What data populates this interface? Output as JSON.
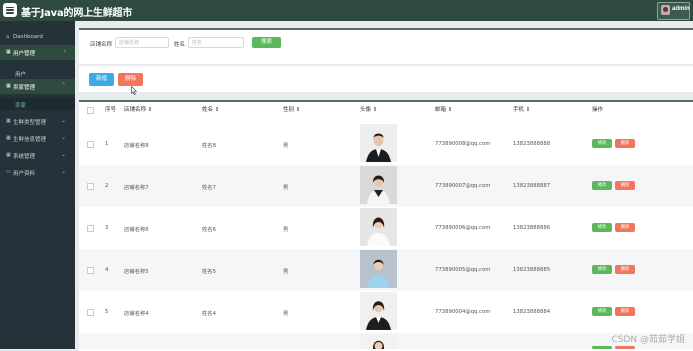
{
  "header": {
    "title": "基于Java的网上生鲜超市",
    "user": "admin"
  },
  "sidebar": {
    "items": [
      {
        "label": "Dashboard",
        "icon": "home-icon",
        "active": false
      },
      {
        "label": "用户管理",
        "icon": "grid-icon",
        "active": true,
        "sub": [
          "用户"
        ]
      },
      {
        "label": "卖家管理",
        "icon": "grid-icon",
        "active": true,
        "sub": [
          "卖家"
        ]
      },
      {
        "label": "生鲜类型管理",
        "icon": "grid-icon",
        "active": false
      },
      {
        "label": "生鲜信息管理",
        "icon": "grid-icon",
        "active": false
      },
      {
        "label": "系统管理",
        "icon": "grid-icon",
        "active": false
      },
      {
        "label": "用户资料",
        "icon": "user-icon",
        "active": false
      }
    ]
  },
  "search": {
    "shop_label": "店铺名称",
    "shop_placeholder": "店铺名称",
    "name_label": "姓名",
    "name_placeholder": "姓名",
    "search_button": "搜索"
  },
  "actions": {
    "add": "新增",
    "delete": "删除"
  },
  "table": {
    "headers": [
      "序号",
      "店铺名称 ⇕",
      "姓名 ⇕",
      "性别 ⇕",
      "头像 ⇕",
      "邮箱 ⇕",
      "手机 ⇕",
      "操作"
    ],
    "row_buttons": {
      "detail": "修改",
      "delete": "删除"
    },
    "rows": [
      {
        "index": "1",
        "shop": "店铺名称8",
        "name": "姓名8",
        "gender": "男",
        "email": "773890008@qq.com",
        "phone": "13823888888"
      },
      {
        "index": "2",
        "shop": "店铺名称7",
        "name": "姓名7",
        "gender": "男",
        "email": "773890007@qq.com",
        "phone": "13823888887"
      },
      {
        "index": "3",
        "shop": "店铺名称6",
        "name": "姓名6",
        "gender": "男",
        "email": "773890006@qq.com",
        "phone": "13823888886"
      },
      {
        "index": "4",
        "shop": "店铺名称5",
        "name": "姓名5",
        "gender": "男",
        "email": "773890005@qq.com",
        "phone": "13823888885"
      },
      {
        "index": "5",
        "shop": "店铺名称4",
        "name": "姓名4",
        "gender": "男",
        "email": "773890004@qq.com",
        "phone": "13823888884"
      }
    ]
  },
  "watermark": "CSDN @茹茹学姐",
  "colors": {
    "header": "#2f4b3f",
    "sidebar": "#26323a",
    "green": "#5cb85c",
    "blue": "#3fa9e6",
    "red": "#f0765e"
  }
}
